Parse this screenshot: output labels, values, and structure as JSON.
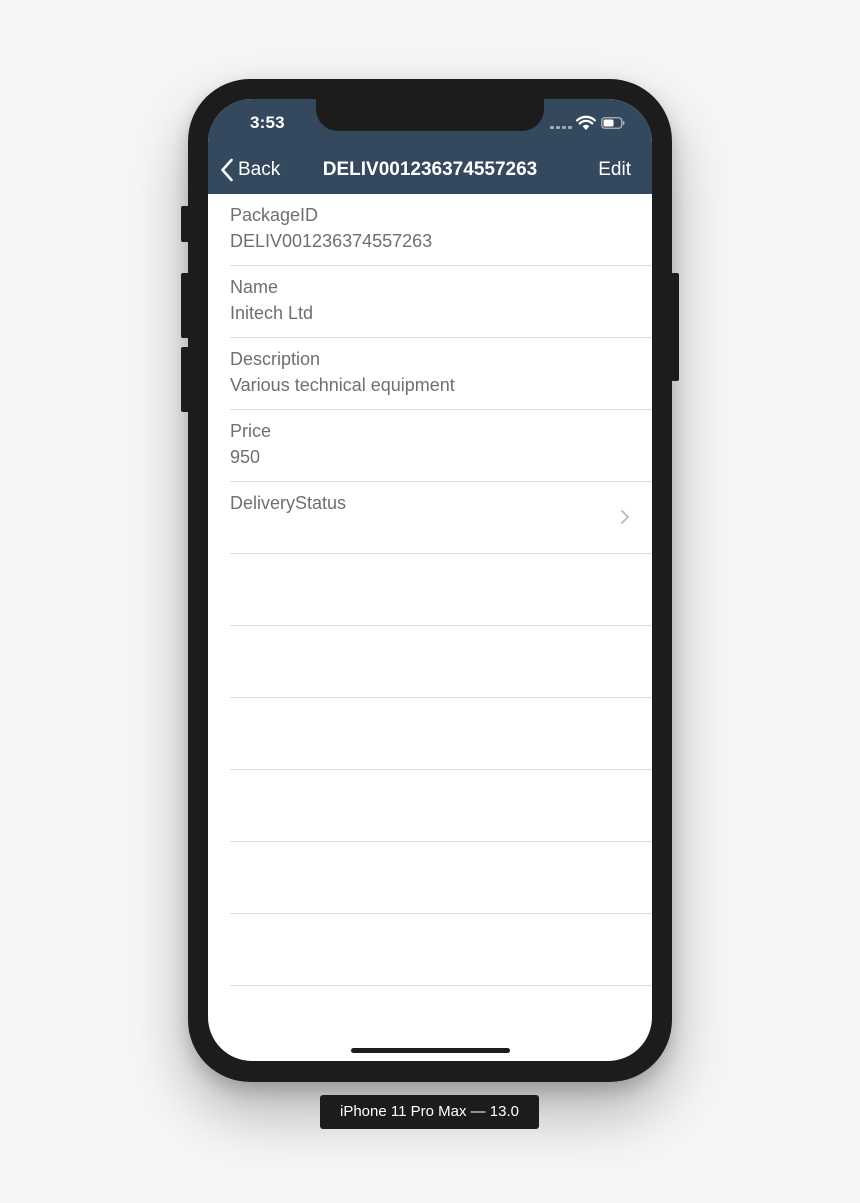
{
  "status_bar": {
    "time": "3:53"
  },
  "nav": {
    "back_label": "Back",
    "title": "DELIV001236374557263",
    "edit_label": "Edit"
  },
  "fields": [
    {
      "label": "PackageID",
      "value": "DELIV001236374557263"
    },
    {
      "label": "Name",
      "value": "Initech Ltd"
    },
    {
      "label": "Description",
      "value": "Various technical equipment"
    },
    {
      "label": "Price",
      "value": "950"
    },
    {
      "label": "DeliveryStatus",
      "value": ""
    }
  ],
  "device_label": "iPhone 11 Pro Max — 13.0",
  "colors": {
    "header": "#34495e",
    "text": "#6f6f6f",
    "background": "#f6f6f6"
  }
}
